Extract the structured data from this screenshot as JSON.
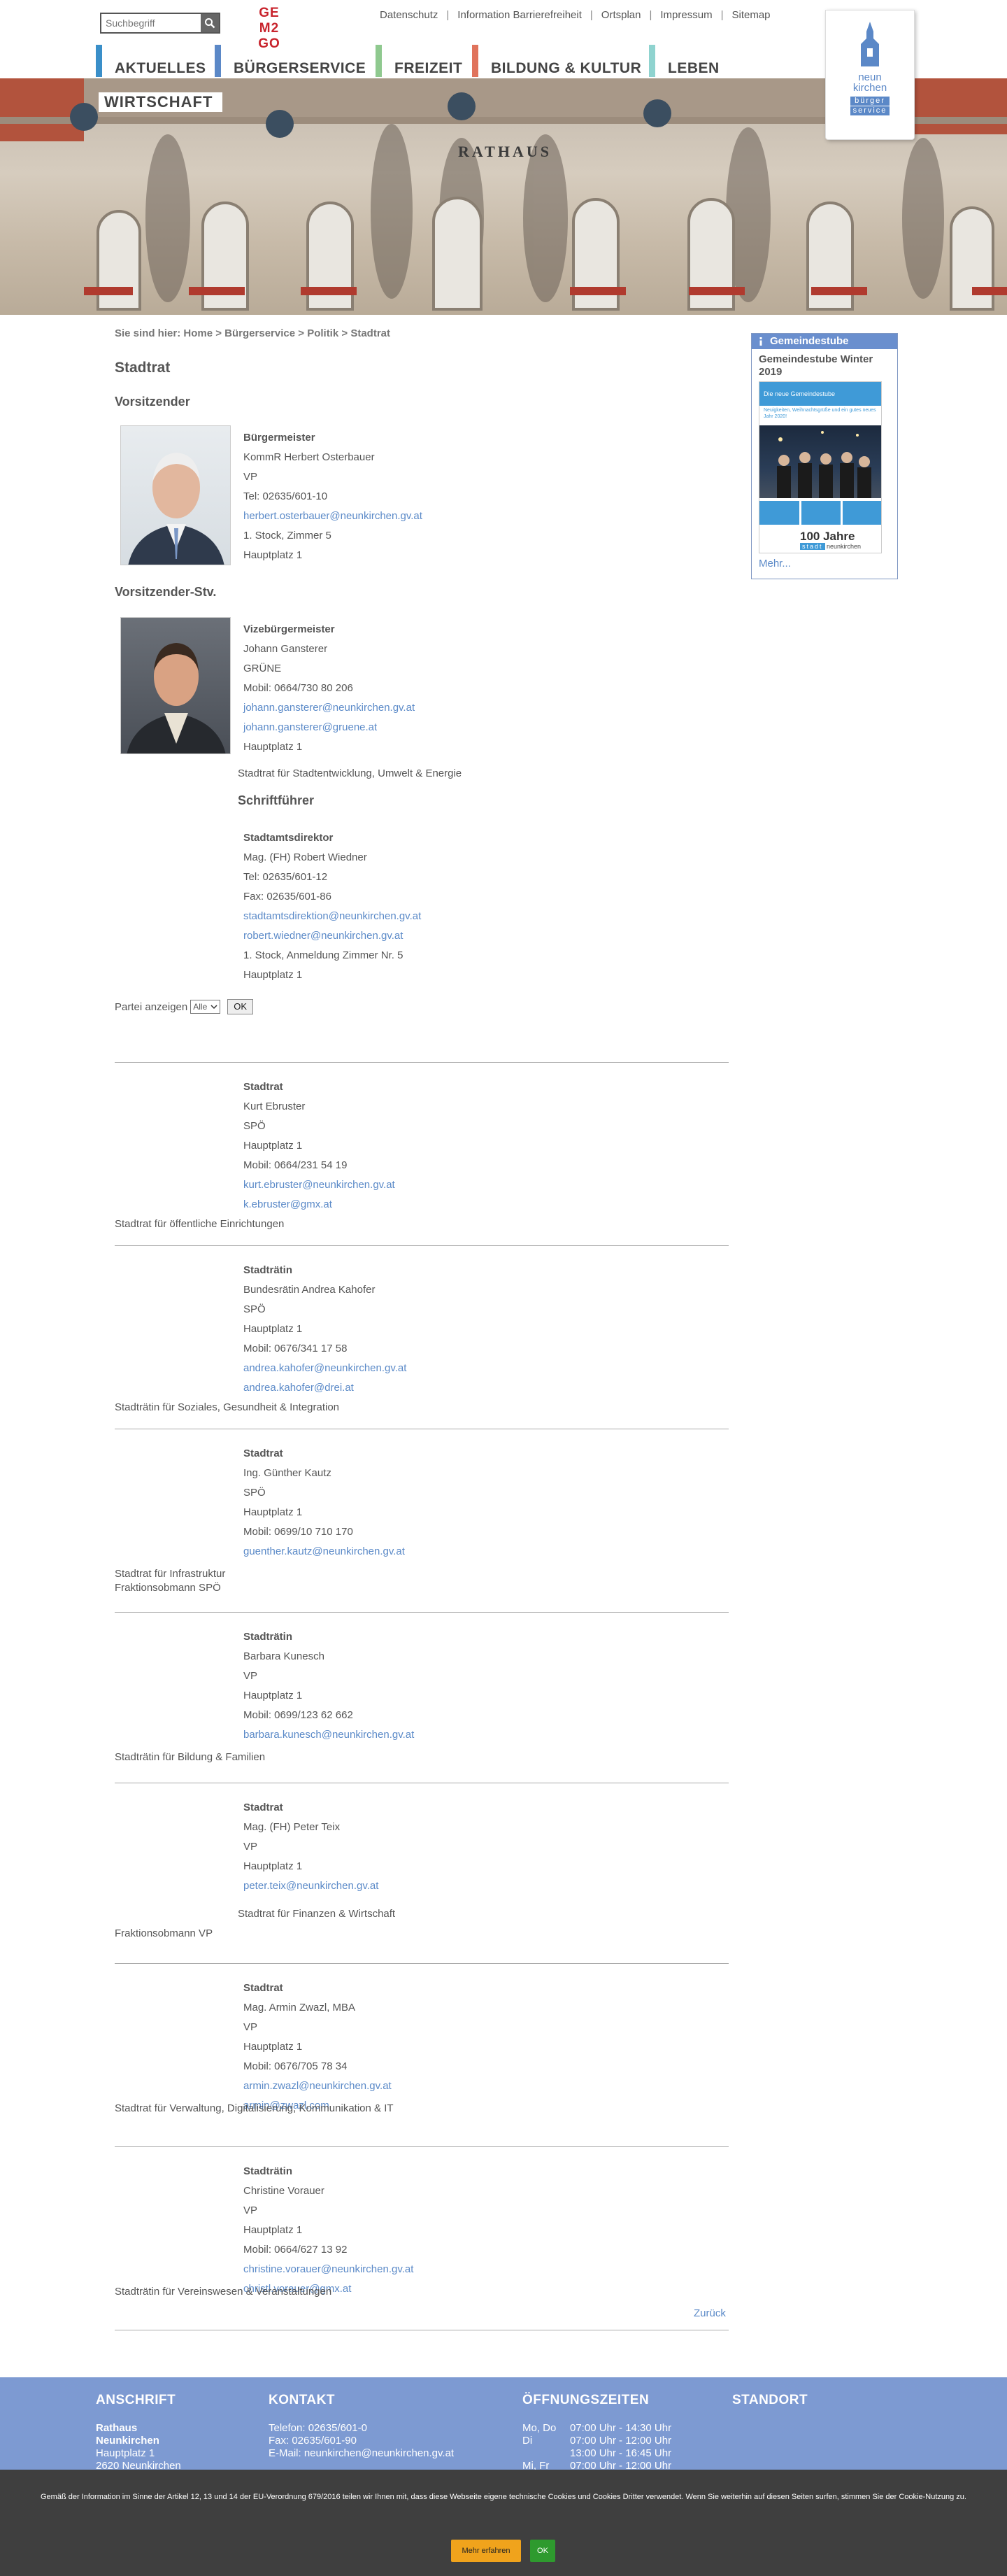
{
  "header": {
    "search_placeholder": "Suchbegriff",
    "gem_logo": "GEM2GO",
    "top_links": [
      "Datenschutz",
      "Information Barrierefreiheit",
      "Ortsplan",
      "Impressum",
      "Sitemap"
    ],
    "nav": [
      {
        "label": "AKTUELLES",
        "color": "#3a8fc9"
      },
      {
        "label": "BÜRGERSERVICE",
        "color": "#5b88c7"
      },
      {
        "label": "FREIZEIT",
        "color": "#8fc98f"
      },
      {
        "label": "BILDUNG & KULTUR",
        "color": "#e0735c"
      },
      {
        "label": "LEBEN",
        "color": "#8fd3cf"
      }
    ],
    "nav_second_row": "WIRTSCHAFT"
  },
  "hero": {
    "building_sign": "RATHAUS"
  },
  "logo": {
    "line1": "neun",
    "line2": "kirchen",
    "line3": "bürger",
    "line4": "service"
  },
  "breadcrumb": {
    "prefix": "Sie sind hier:",
    "items": [
      "Home",
      "Bürgerservice",
      "Politik",
      "Stadtrat"
    ]
  },
  "page_title": "Stadtrat",
  "section_vorsitz": "Vorsitzender",
  "section_stv": "Vorsitzender-Stv.",
  "section_schrift": "Schriftführer",
  "buergermeister": {
    "role": "Bürgermeister",
    "name": "KommR Herbert Osterbauer",
    "party": "VP",
    "phone": "Tel: 02635/601-10",
    "email": "herbert.osterbauer@neunkirchen.gv.at",
    "room": "1. Stock, Zimmer 5",
    "address": "Hauptplatz 1"
  },
  "vize": {
    "role": "Vizebürgermeister",
    "name": "Johann Gansterer",
    "party": "GRÜNE",
    "phone": "Mobil: 0664/730 80 206",
    "email1": "johann.gansterer@neunkirchen.gv.at",
    "email2": "johann.gansterer@gruene.at",
    "address": "Hauptplatz 1",
    "function": "Stadtrat für Stadtentwicklung, Umwelt & Energie"
  },
  "schrift": {
    "role": "Stadtamtsdirektor",
    "name": "Mag. (FH) Robert Wiedner",
    "phone": "Tel: 02635/601-12",
    "fax": "Fax: 02635/601-86",
    "email1": "stadtamtsdirektion@neunkirchen.gv.at",
    "email2": "robert.wiedner@neunkirchen.gv.at",
    "room": "1. Stock, Anmeldung Zimmer Nr. 5",
    "address": "Hauptplatz 1"
  },
  "filter": {
    "label": "Partei anzeigen",
    "select_value": "Alle",
    "ok": "OK"
  },
  "members": [
    {
      "role": "Stadtrat",
      "lines": [
        "Kurt Ebruster",
        "SPÖ",
        "Hauptplatz 1",
        "Mobil: 0664/231 54 19"
      ],
      "emails": [
        "kurt.ebruster@neunkirchen.gv.at",
        "k.ebruster@gmx.at"
      ],
      "function": "Stadtrat für öffentliche Einrichtungen"
    },
    {
      "role": "Stadträtin",
      "lines": [
        "Bundesrätin Andrea Kahofer",
        "SPÖ",
        "Hauptplatz 1",
        "Mobil: 0676/341 17 58"
      ],
      "emails": [
        "andrea.kahofer@neunkirchen.gv.at",
        "andrea.kahofer@drei.at"
      ],
      "function": "Stadträtin für Soziales, Gesundheit & Integration"
    },
    {
      "role": "Stadtrat",
      "lines": [
        "Ing. Günther Kautz",
        "SPÖ",
        "Hauptplatz 1",
        "Mobil: 0699/10 710 170"
      ],
      "emails": [
        "guenther.kautz@neunkirchen.gv.at"
      ],
      "function": "Stadtrat für Infrastruktur",
      "function2": "Fraktionsobmann SPÖ"
    },
    {
      "role": "Stadträtin",
      "lines": [
        "Barbara Kunesch",
        "VP",
        "Hauptplatz 1",
        "Mobil: 0699/123 62 662"
      ],
      "emails": [
        "barbara.kunesch@neunkirchen.gv.at"
      ],
      "function": "Stadträtin für Bildung & Familien"
    },
    {
      "role": "Stadtrat",
      "lines": [
        "Mag. (FH) Peter Teix",
        "VP",
        "Hauptplatz 1"
      ],
      "emails": [
        "peter.teix@neunkirchen.gv.at"
      ],
      "function": "Stadtrat für Finanzen & Wirtschaft",
      "function2": "Fraktionsobmann VP"
    },
    {
      "role": "Stadtrat",
      "lines": [
        "Mag. Armin Zwazl, MBA",
        "VP",
        "Hauptplatz 1",
        "Mobil: 0676/705 78 34"
      ],
      "emails": [
        "armin.zwazl@neunkirchen.gv.at",
        "armin@zwazl.com"
      ],
      "function": "Stadtrat für Verwaltung, Digitalisierung, Kommunikation & IT"
    },
    {
      "role": "Stadträtin",
      "lines": [
        "Christine Vorauer",
        "VP",
        "Hauptplatz 1",
        "Mobil: 0664/627 13 92"
      ],
      "emails": [
        "christine.vorauer@neunkirchen.gv.at",
        "christl.vorauer@gmx.at"
      ],
      "function": "Stadträtin für Vereinswesen & Veranstaltungen"
    }
  ],
  "back_link": "Zurück",
  "sidebar": {
    "header": "Gemeindestube",
    "title": "Gemeindestube Winter 2019",
    "cover_banner": "Die neue Gemeindestube",
    "cover_text": "Neuigkeiten, Weihnachtsgrüße und ein gutes neues Jahr 2020!",
    "jahre": "100 Jahre",
    "stadt": "stadt",
    "town": "neunkirchen",
    "more": "Mehr..."
  },
  "footer": {
    "anschrift_title": "ANSCHRIFT",
    "anschrift": [
      "Rathaus",
      "Neunkirchen",
      "Hauptplatz 1",
      "2620 Neunkirchen"
    ],
    "kontakt_title": "KONTAKT",
    "kontakt": [
      "Telefon: 02635/601-0",
      "Fax: 02635/601-90",
      "E-Mail: neunkirchen@neunkirchen.gv.at"
    ],
    "oeffnung_title": "ÖFFNUNGSZEITEN",
    "oeffnung": [
      {
        "day": "Mo, Do",
        "time": "07:00 Uhr - 14:30 Uhr"
      },
      {
        "day": "Di",
        "time": "07:00 Uhr - 12:00 Uhr"
      },
      {
        "day": "",
        "time": "13:00 Uhr - 16:45 Uhr"
      },
      {
        "day": "Mi, Fr",
        "time": "07:00 Uhr - 12:00 Uhr"
      }
    ],
    "standort_title": "STANDORT"
  },
  "cookie": {
    "text": "Gemäß der Information im Sinne der Artikel 12, 13 und 14 der EU-Verordnung 679/2016 teilen wir Ihnen mit, dass diese Webseite eigene technische Cookies und Cookies Dritter verwendet. Wenn Sie weiterhin auf diesen Seiten surfen, stimmen Sie der Cookie-Nutzung zu.",
    "more_button": "Mehr erfahren",
    "ok_button": "OK"
  }
}
